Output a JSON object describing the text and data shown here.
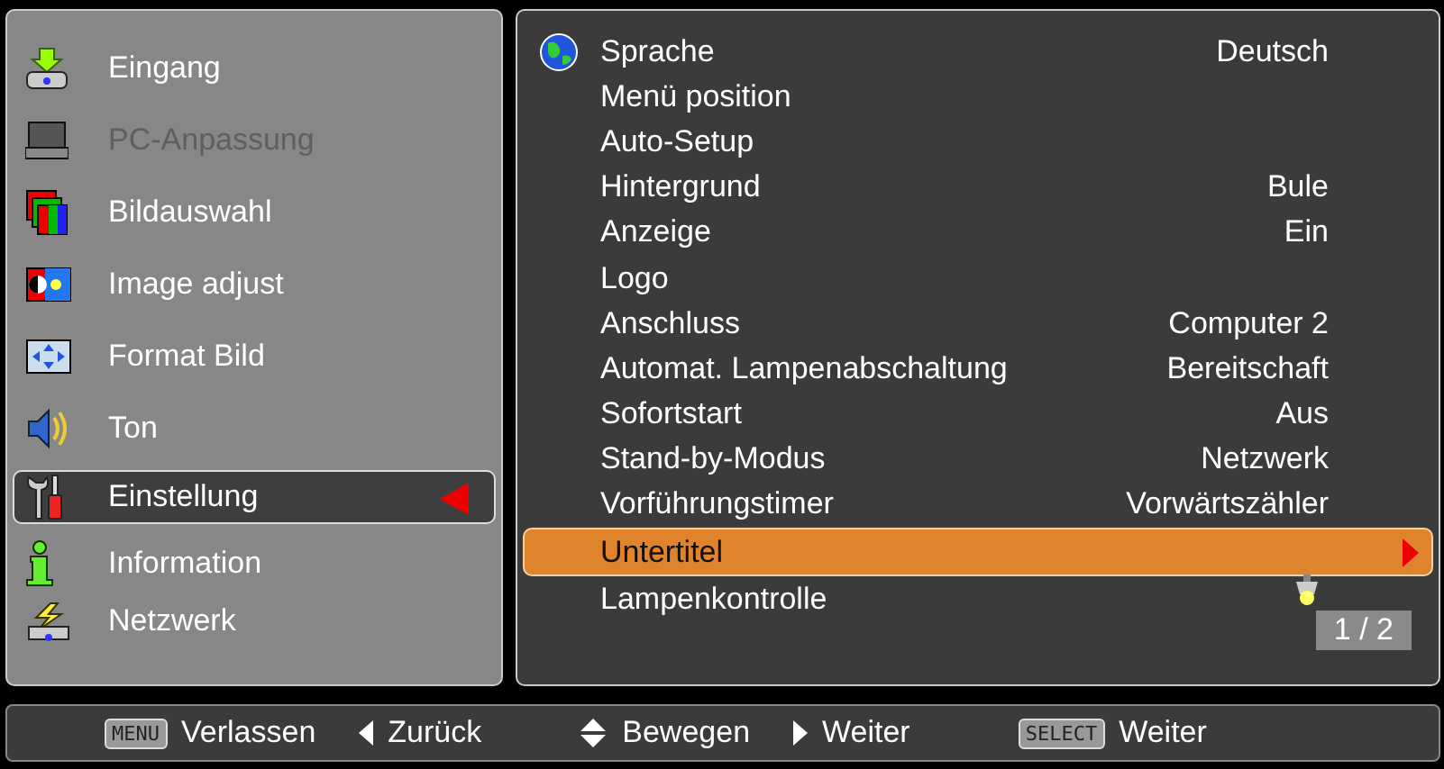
{
  "menu": [
    {
      "label": "Eingang",
      "disabled": false,
      "selected": false
    },
    {
      "label": "PC-Anpassung",
      "disabled": true,
      "selected": false
    },
    {
      "label": "Bildauswahl",
      "disabled": false,
      "selected": false
    },
    {
      "label": "Image adjust",
      "disabled": false,
      "selected": false
    },
    {
      "label": "Format Bild",
      "disabled": false,
      "selected": false
    },
    {
      "label": "Ton",
      "disabled": false,
      "selected": false
    },
    {
      "label": "Einstellung",
      "disabled": false,
      "selected": true
    },
    {
      "label": "Information",
      "disabled": false,
      "selected": false
    },
    {
      "label": "Netzwerk",
      "disabled": false,
      "selected": false
    }
  ],
  "settings": [
    {
      "kind": "value",
      "label": "Sprache",
      "value": "Deutsch",
      "selected": false
    },
    {
      "kind": "value",
      "label": "Menü position",
      "selected": false
    },
    {
      "kind": "value",
      "label": "Auto-Setup",
      "selected": false
    },
    {
      "kind": "value",
      "label": "Hintergrund",
      "value": "Bule",
      "selected": false
    },
    {
      "kind": "value",
      "label": "Anzeige",
      "value": "Ein",
      "selected": false
    },
    {
      "kind": "value",
      "label": "Logo",
      "selected": false
    },
    {
      "kind": "value",
      "label": "Anschluss",
      "value": "Computer 2",
      "selected": false
    },
    {
      "kind": "value",
      "label": "Automat. Lampenabschaltung",
      "value": "Bereitschaft",
      "selected": false
    },
    {
      "kind": "value",
      "label": "Sofortstart",
      "value": "Aus",
      "selected": false
    },
    {
      "kind": "value",
      "label": "Stand-by-Modus",
      "value": "Netzwerk",
      "selected": false
    },
    {
      "kind": "value",
      "label": "Vorführungstimer",
      "value": "Vorwärtszähler",
      "selected": false
    },
    {
      "kind": "value",
      "label": "Untertitel",
      "selected": true
    },
    {
      "kind": "lamp",
      "label": "Lampenkontrolle",
      "selected": false
    }
  ],
  "page": "1 / 2",
  "footer": [
    {
      "kind": "key",
      "key": "MENU",
      "label": "Verlassen"
    },
    {
      "kind": "left",
      "label": "Zurück"
    },
    {
      "kind": "updown",
      "label": "Bewegen"
    },
    {
      "kind": "right",
      "label": "Weiter"
    },
    {
      "kind": "key",
      "key": "SELECT",
      "label": "Weiter"
    }
  ]
}
